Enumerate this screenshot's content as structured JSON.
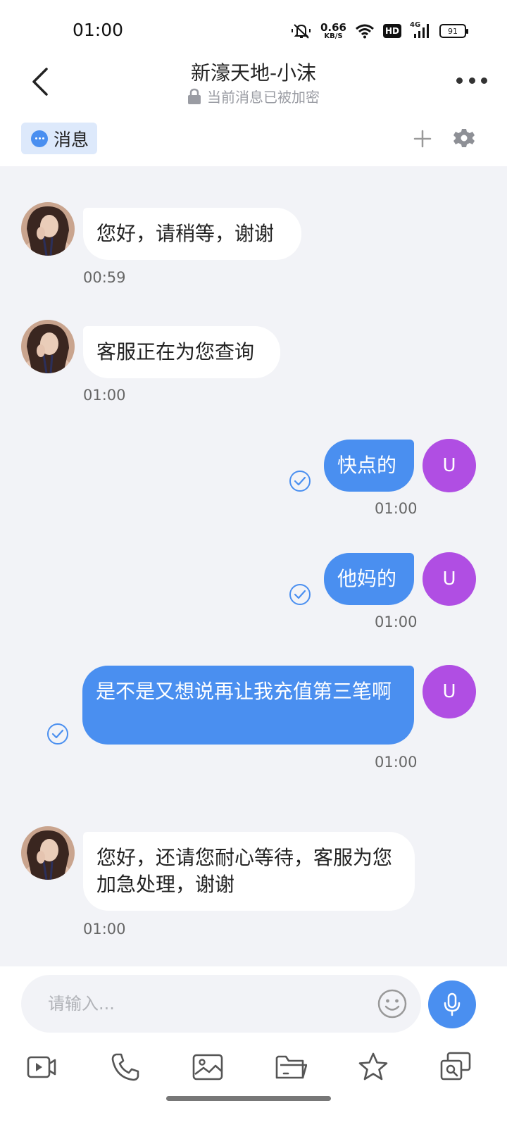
{
  "status_bar": {
    "time": "01:00",
    "net_speed": "0.66",
    "net_speed_unit": "KB/S",
    "hd": "HD",
    "network": "4G",
    "battery": "91"
  },
  "header": {
    "title": "新濠天地-小沫",
    "subtitle": "当前消息已被加密"
  },
  "tabs": {
    "messages_label": "消息"
  },
  "messages": [
    {
      "side": "in",
      "text": "您好，请稍等，谢谢",
      "time": "00:59"
    },
    {
      "side": "in",
      "text": "客服正在为您查询",
      "time": "01:00"
    },
    {
      "side": "out",
      "text": "快点的",
      "time": "01:00",
      "avatar": "U"
    },
    {
      "side": "out",
      "text": "他妈的",
      "time": "01:00",
      "avatar": "U"
    },
    {
      "side": "out",
      "text": "是不是又想说再让我充值第三笔啊",
      "time": "01:00",
      "avatar": "U"
    },
    {
      "side": "in",
      "text": "您好，还请您耐心等待，客服为您加急处理，谢谢",
      "time": "01:00"
    }
  ],
  "composer": {
    "placeholder": "请输入..."
  },
  "toolbar_icons": [
    "video-icon",
    "phone-icon",
    "image-icon",
    "folder-icon",
    "star-icon",
    "screenshot-icon"
  ],
  "colors": {
    "accent": "#4a8ff0",
    "user_avatar": "#b04ee3",
    "chat_bg": "#f2f3f7"
  }
}
